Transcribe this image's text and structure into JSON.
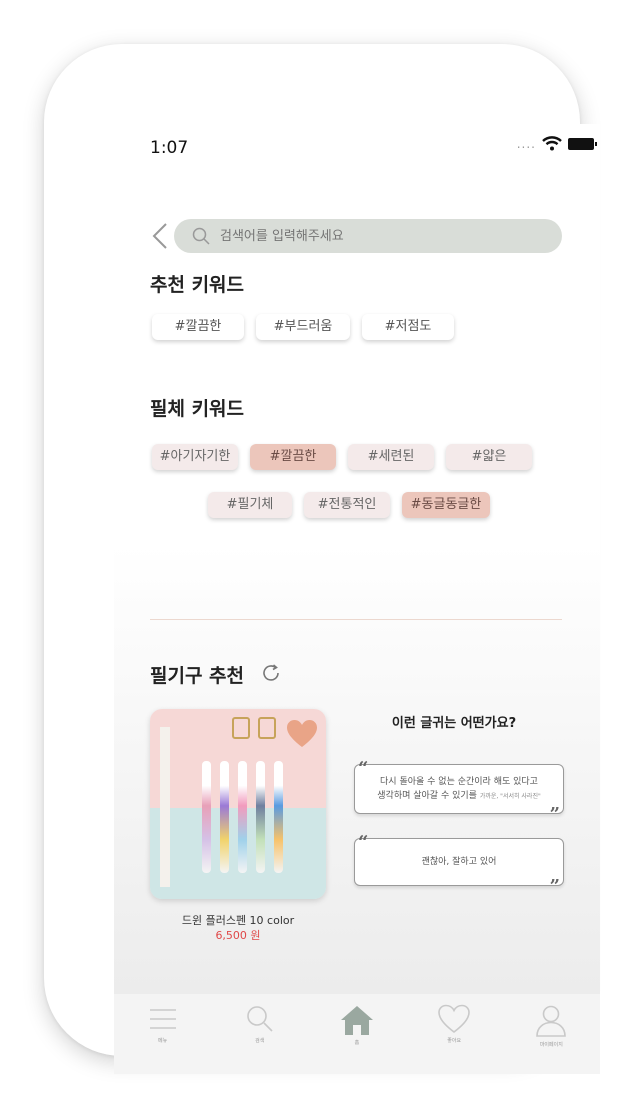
{
  "status_bar": {
    "time": "1:07",
    "signal": "...."
  },
  "search": {
    "placeholder": "검색어를 입력해주세요"
  },
  "recommended_keywords": {
    "title": "추천 키워드",
    "chips": [
      "#깔끔한",
      "#부드러움",
      "#저점도"
    ]
  },
  "handwriting_keywords": {
    "title": "필체 키워드",
    "chips": [
      {
        "label": "#아기자기한",
        "selected": false
      },
      {
        "label": "#깔끔한",
        "selected": true
      },
      {
        "label": "#세련된",
        "selected": false
      },
      {
        "label": "#얇은",
        "selected": false
      },
      {
        "label": "#필기체",
        "selected": false
      },
      {
        "label": "#전통적인",
        "selected": false
      },
      {
        "label": "#동글동글한",
        "selected": true
      }
    ]
  },
  "pen_recommendation": {
    "title": "필기구 추천",
    "product": {
      "name": "드윈 플러스펜 10 color",
      "price": "6,500 원"
    },
    "quote_heading": "이런 글귀는 어떤가요?",
    "quotes": [
      {
        "line1": "다시 돌아올 수 없는 순간이라 해도 있다고",
        "line2": "생각하며 살아갈 수 있기를",
        "source": "가까운, \"서서히 사라진\""
      },
      {
        "line1": "괜찮아, 잘하고 있어",
        "line2": "",
        "source": ""
      }
    ]
  },
  "colors": {
    "accent": "#ecc6bb",
    "search_bg": "#d9ddd8",
    "price": "#e04848",
    "nav_icon": "#9aa8a0"
  },
  "bottom_nav": [
    {
      "label": "메뉴",
      "icon": "menu-icon"
    },
    {
      "label": "검색",
      "icon": "search-icon"
    },
    {
      "label": "홈",
      "icon": "home-icon"
    },
    {
      "label": "좋아요",
      "icon": "heart-icon"
    },
    {
      "label": "마이페이지",
      "icon": "user-icon"
    }
  ]
}
